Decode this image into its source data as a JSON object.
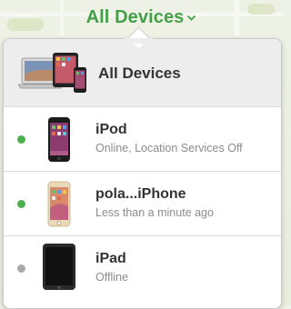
{
  "header": {
    "title": "All Devices",
    "color": "#43a047"
  },
  "menu": {
    "all_devices_label": "All Devices",
    "devices": [
      {
        "name": "iPod",
        "status": "Online, Location Services Off",
        "online": true,
        "dot_color": "#4caf50",
        "icon": "ipod-icon"
      },
      {
        "name": "pola...iPhone",
        "status": "Less than a minute ago",
        "online": true,
        "dot_color": "#4caf50",
        "icon": "iphone-icon"
      },
      {
        "name": "iPad",
        "status": "Offline",
        "online": false,
        "dot_color": "#a8a8a8",
        "icon": "ipad-icon"
      }
    ]
  }
}
